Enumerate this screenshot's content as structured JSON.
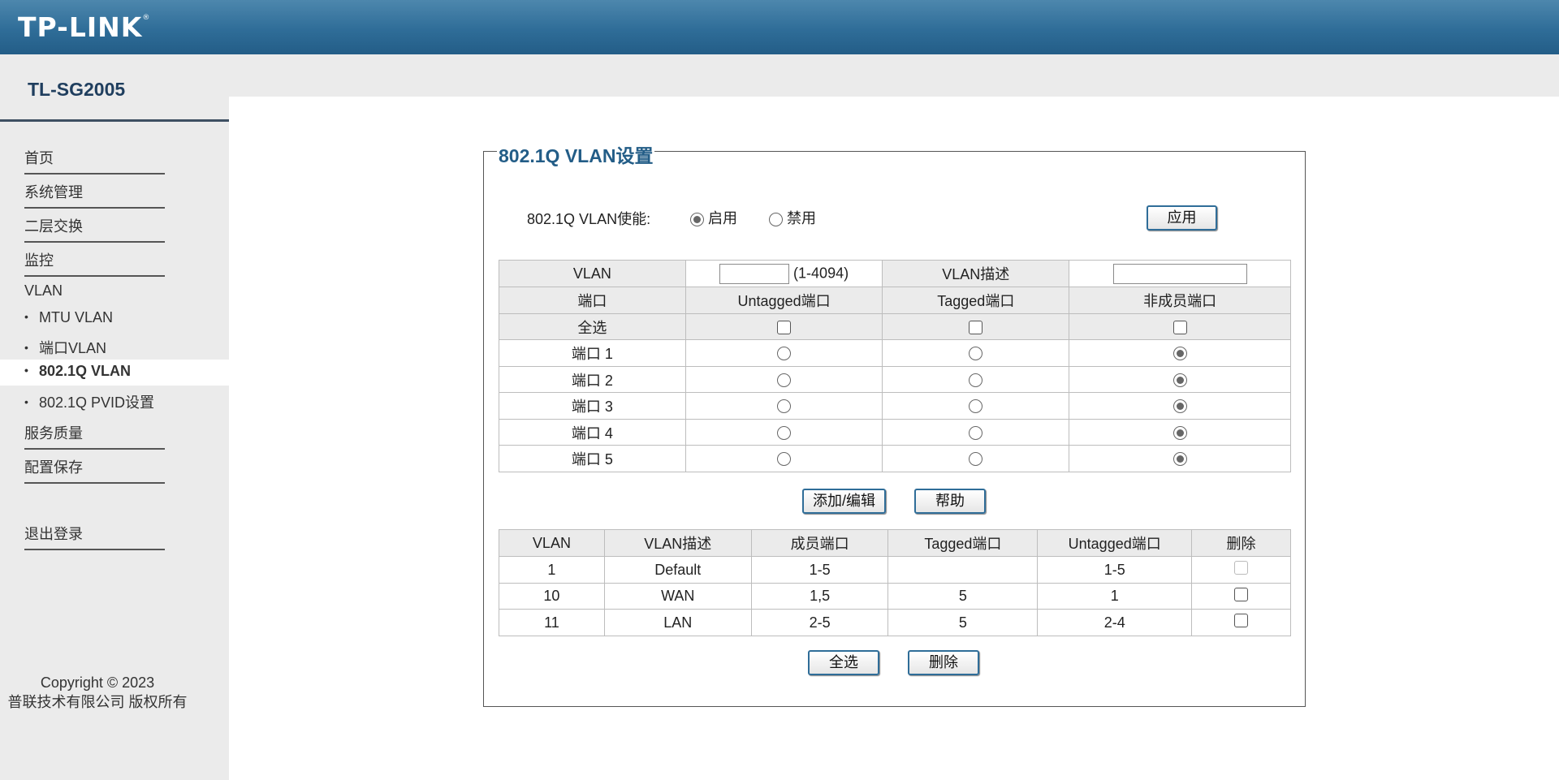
{
  "header": {
    "brand": "TP-LINK",
    "brand_mark": "®"
  },
  "sidebar": {
    "model": "TL-SG2005",
    "items": [
      {
        "label": "首页"
      },
      {
        "label": "系统管理"
      },
      {
        "label": "二层交换"
      },
      {
        "label": "监控"
      }
    ],
    "vlan_group": {
      "label": "VLAN",
      "sub_items": [
        {
          "label": "MTU VLAN",
          "active": false
        },
        {
          "label": "端口VLAN",
          "active": false
        },
        {
          "label": "802.1Q VLAN",
          "active": true
        },
        {
          "label": "802.1Q PVID设置",
          "active": false
        }
      ]
    },
    "items_after": [
      {
        "label": "服务质量"
      },
      {
        "label": "配置保存"
      }
    ],
    "logout": "退出登录",
    "copyright_line1": "Copyright © 2023",
    "copyright_line2": "普联技术有限公司 版权所有",
    "bullet": "•"
  },
  "panel": {
    "title": "802.1Q VLAN设置",
    "enable_label": "802.1Q VLAN使能:",
    "enable_option": "启用",
    "disable_option": "禁用",
    "enabled": true,
    "apply_button": "应用"
  },
  "config_table": {
    "vlan_label": "VLAN",
    "vlan_id_value": "",
    "vlan_range": "(1-4094)",
    "desc_label": "VLAN描述",
    "desc_value": "",
    "columns": [
      "端口",
      "Untagged端口",
      "Tagged端口",
      "非成员端口"
    ],
    "select_all_label": "全选",
    "ports": [
      {
        "label": "端口 1",
        "selected": "non_member"
      },
      {
        "label": "端口 2",
        "selected": "non_member"
      },
      {
        "label": "端口 3",
        "selected": "non_member"
      },
      {
        "label": "端口 4",
        "selected": "non_member"
      },
      {
        "label": "端口 5",
        "selected": "non_member"
      }
    ],
    "add_edit_button": "添加/编辑",
    "help_button": "帮助"
  },
  "vlan_list": {
    "columns": [
      "VLAN",
      "VLAN描述",
      "成员端口",
      "Tagged端口",
      "Untagged端口",
      "删除"
    ],
    "rows": [
      {
        "vlan": "1",
        "desc": "Default",
        "members": "1-5",
        "tagged": "",
        "untagged": "1-5",
        "deletable": false
      },
      {
        "vlan": "10",
        "desc": "WAN",
        "members": "1,5",
        "tagged": "5",
        "untagged": "1",
        "deletable": true
      },
      {
        "vlan": "11",
        "desc": "LAN",
        "members": "2-5",
        "tagged": "5",
        "untagged": "2-4",
        "deletable": true
      }
    ],
    "select_all_button": "全选",
    "delete_button": "删除"
  }
}
